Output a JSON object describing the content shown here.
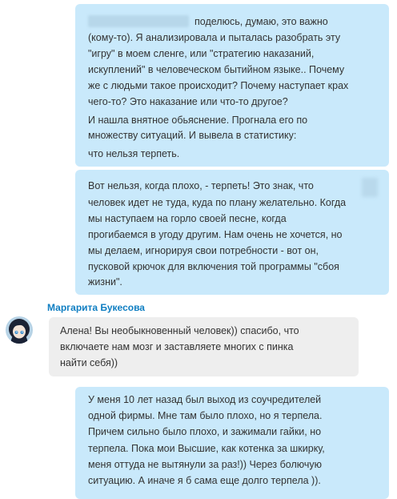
{
  "messages": [
    {
      "direction": "outgoing",
      "lines": [
        "поделюсь, думаю, это важно",
        "(кому-то).  Я анализировала и пыталась разобрать эту",
        "\"игру\" в моем сленге, или \"стратегию наказаний,",
        "искуплений\" в человеческом бытийном языке.. Почему",
        "же с людьми такое происходит? Почему наступает крах",
        "чего-то? Это наказание или что-то другое?",
        "И нашла внятное обьяснение. Прогнала его по",
        "множеству ситуаций. И вывела в статистику:",
        "что нельзя терпеть."
      ]
    },
    {
      "direction": "outgoing",
      "lines": [
        "Вот нельзя, когда плохо, - терпеть! Это знак, что",
        "человек идет не туда, куда по плану желательно. Когда",
        "мы наступаем на горло своей песне, когда",
        "прогибаемся в угоду другим. Нам очень не хочется, но",
        "мы делаем, игнорируя свои потребности - вот он,",
        "пусковой крючок для включения той программы \"сбоя",
        "жизни\"."
      ]
    },
    {
      "direction": "incoming",
      "sender": "Маргарита Букесова",
      "lines": [
        "Алена! Вы необыкновенный человек)) спасибо, что",
        "включаете нам мозг и заставляете многих с пинка",
        "найти себя))"
      ]
    },
    {
      "direction": "outgoing",
      "lines": [
        "У меня 10 лет назад был выход из соучредителей",
        "одной фирмы. Мне там было плохо, но я терпела.",
        "Причем сильно было плохо, и зажимали гайки, но",
        "терпела. Пока мои Высшие, как котенка за шкирку,",
        "меня оттуда не вытянули за раз!)) Через болючую",
        "ситуацию. А иначе я б сама еще долго терпела ))."
      ]
    }
  ],
  "colors": {
    "outgoing_bubble": "#c9e9fb",
    "incoming_bubble": "#eeeeee",
    "sender_name": "#0f7ec2",
    "text": "#333333"
  }
}
